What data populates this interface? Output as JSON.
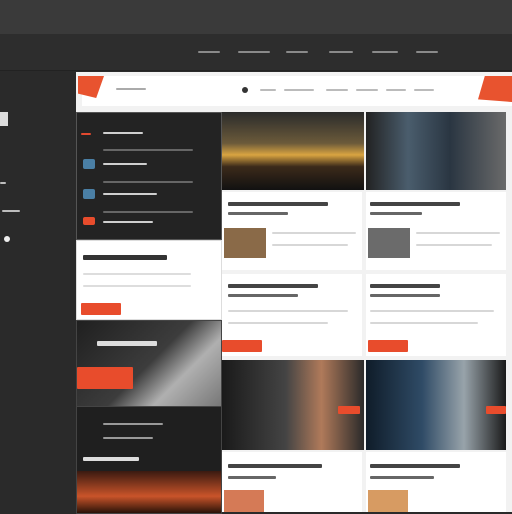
{
  "top_nav": {
    "items": [
      "",
      "",
      "",
      "",
      "",
      ""
    ],
    "corner_text": ""
  },
  "left_panel": {
    "items": [
      "",
      "",
      "",
      ""
    ]
  },
  "content_header": {
    "nav": [
      "",
      "",
      "",
      "",
      "",
      "",
      "",
      ""
    ]
  },
  "sidebar": {
    "list": [
      "",
      "",
      "",
      ""
    ]
  },
  "cards": [
    {
      "title": ""
    },
    {
      "title": ""
    },
    {
      "title": ""
    },
    {
      "title": ""
    },
    {
      "title": ""
    },
    {
      "title": ""
    }
  ],
  "colors": {
    "accent": "#e84c2c",
    "bg": "#2a2a2a"
  }
}
